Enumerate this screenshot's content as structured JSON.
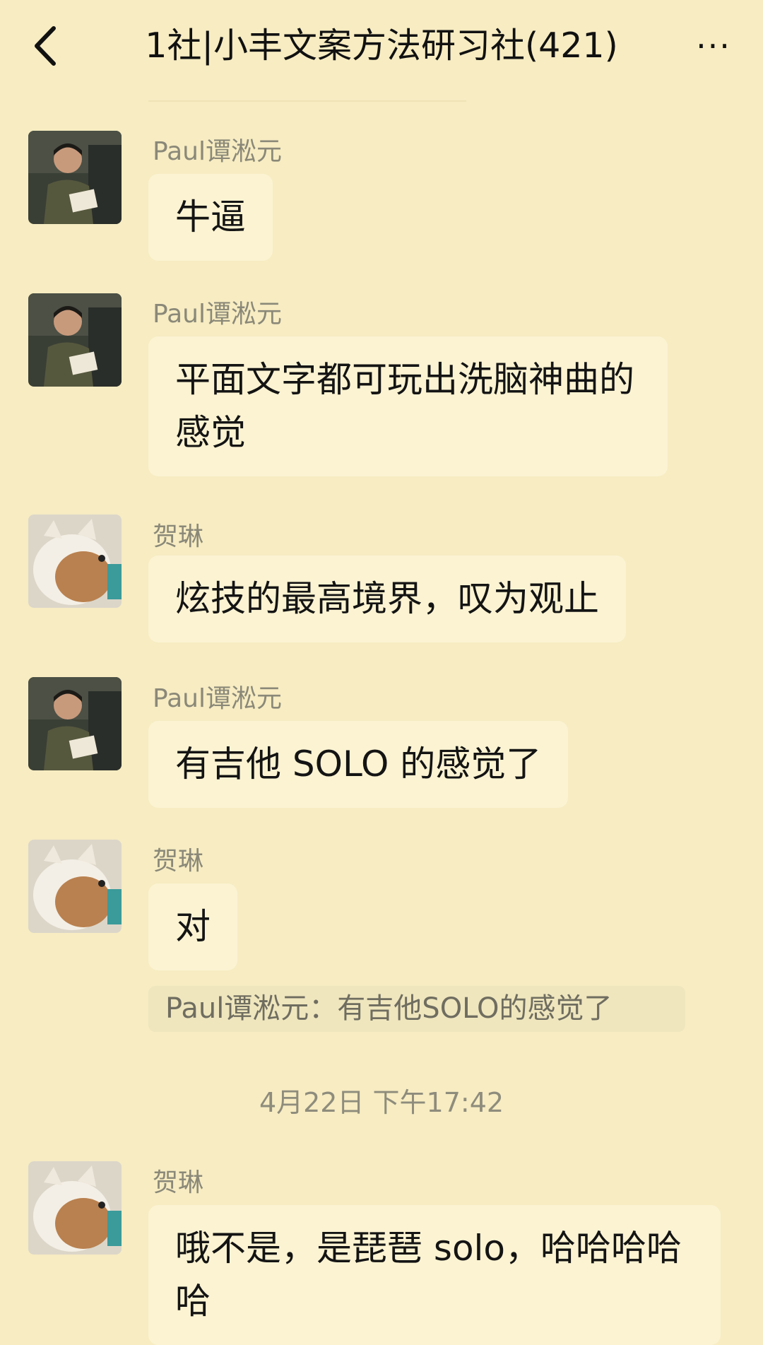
{
  "header": {
    "title": "1社|小丰文案方法研习社(421)",
    "more_label": "···"
  },
  "messages": [
    {
      "sender": "Paul谭淞元",
      "text": "牛逼",
      "avatar": "paul"
    },
    {
      "sender": "Paul谭淞元",
      "text": "平面文字都可玩出洗脑神曲的感觉",
      "avatar": "paul"
    },
    {
      "sender": "贺琳",
      "text": "炫技的最高境界，叹为观止",
      "avatar": "cat"
    },
    {
      "sender": "Paul谭淞元",
      "text": "有吉他 SOLO 的感觉了",
      "avatar": "paul"
    },
    {
      "sender": "贺琳",
      "text": "对",
      "avatar": "cat",
      "quote": "Paul谭淞元：有吉他SOLO的感觉了"
    },
    {
      "sender": "贺琳",
      "text": "哦不是，是琵琶 solo，哈哈哈哈哈",
      "avatar": "cat"
    }
  ],
  "timestamp": "4月22日 下午17:42",
  "colors": {
    "background": "#f7ecc2",
    "bubble": "#fbf3d2",
    "sender_text": "#8a8878"
  }
}
